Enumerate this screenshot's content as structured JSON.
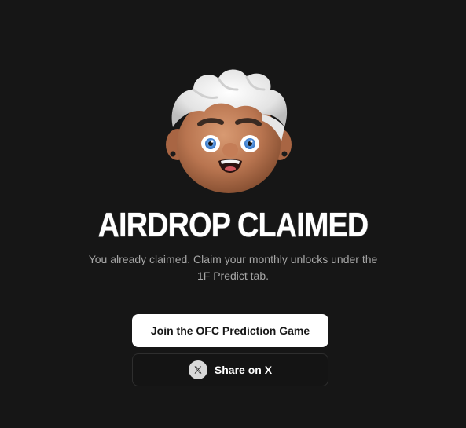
{
  "hero": {
    "avatar_icon": "cartoon-avatar-icon",
    "title": "AIRDROP CLAIMED",
    "subtitle": "You already claimed. Claim your monthly unlocks under the 1F Predict tab."
  },
  "actions": {
    "primary_label": "Join the OFC Prediction Game",
    "share_label": "Share on X",
    "share_icon": "x-logo-icon"
  },
  "colors": {
    "background": "#161616",
    "primary_button_bg": "#ffffff",
    "primary_button_text": "#161616",
    "secondary_button_bg": "#141414",
    "secondary_button_border": "#2e2e2e",
    "subtitle_text": "#a6a6a6"
  }
}
